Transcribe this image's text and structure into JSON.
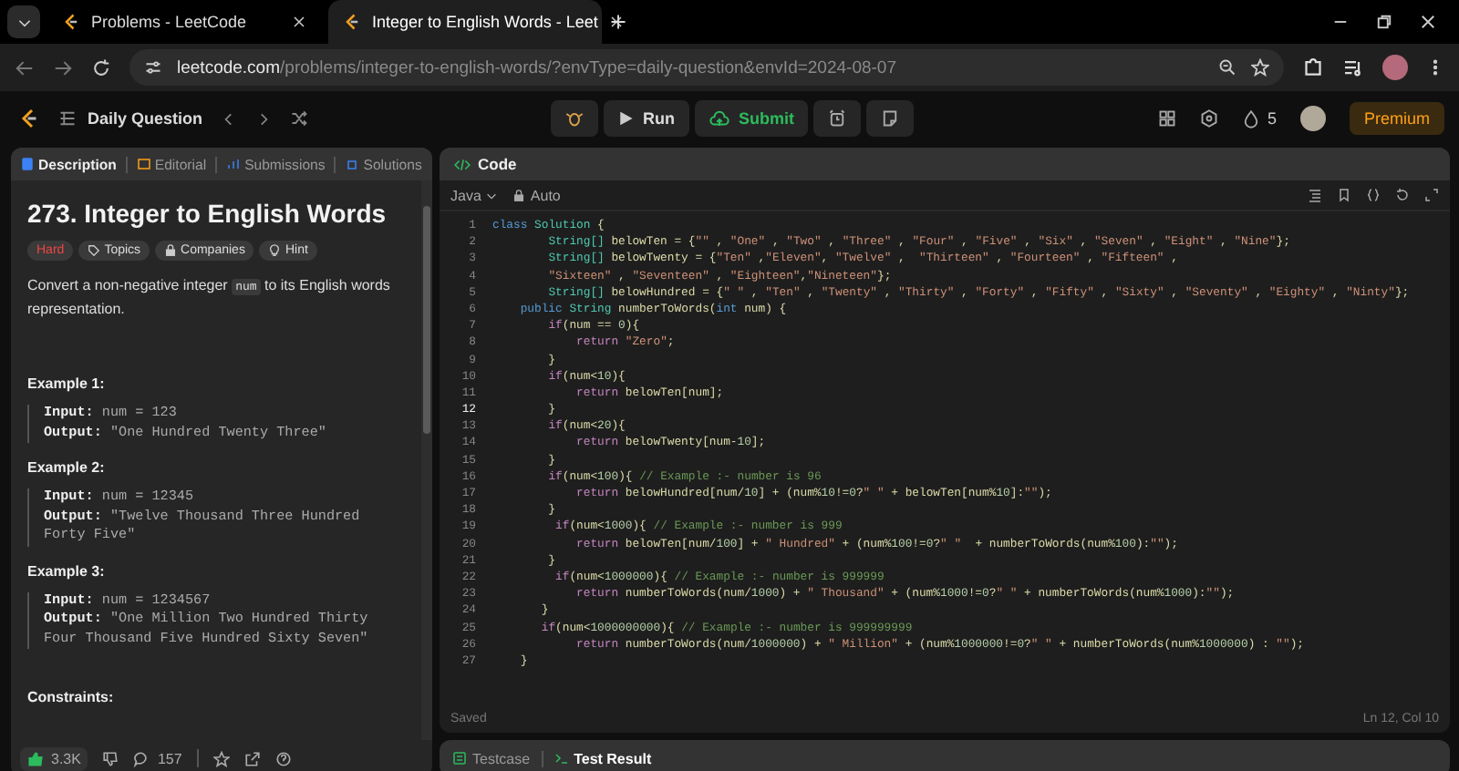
{
  "browser": {
    "tabs": [
      {
        "title": "Problems - LeetCode",
        "selected": false
      },
      {
        "title": "Integer to English Words - Leet",
        "selected": true
      }
    ],
    "url_host": "leetcode.com",
    "url_path": "/problems/integer-to-english-words/?envType=daily-question&envId=2024-08-07"
  },
  "topbar": {
    "daily": "Daily Question",
    "run": "Run",
    "submit": "Submit",
    "streak": "5",
    "premium": "Premium"
  },
  "description": {
    "tabs": [
      {
        "label": "Description",
        "selected": true
      },
      {
        "label": "Editorial",
        "selected": false
      },
      {
        "label": "Submissions",
        "selected": false
      },
      {
        "label": "Solutions",
        "selected": false
      }
    ],
    "title": "273. Integer to English Words",
    "tags": [
      {
        "label": "Hard",
        "kind": "difficulty"
      },
      {
        "label": "Topics",
        "kind": "topics"
      },
      {
        "label": "Companies",
        "kind": "companies"
      },
      {
        "label": "Hint",
        "kind": "hint"
      }
    ],
    "statement": [
      {
        "kind": "text",
        "text": "Convert a non-negative integer "
      },
      {
        "kind": "code",
        "text": "num"
      },
      {
        "kind": "text",
        "text": " to its English words representation."
      }
    ],
    "examples": [
      {
        "heading": "Example 1:",
        "input_label": "Input:",
        "input": "num = 123",
        "output_label": "Output:",
        "output": "\"One Hundred Twenty Three\""
      },
      {
        "heading": "Example 2:",
        "input_label": "Input:",
        "input": "num = 12345",
        "output_label": "Output:",
        "output": "\"Twelve Thousand Three Hundred Forty Five\""
      },
      {
        "heading": "Example 3:",
        "input_label": "Input:",
        "input": "num = 1234567",
        "output_label": "Output:",
        "output": "\"One Million Two Hundred Thirty Four Thousand Five Hundred Sixty Seven\""
      }
    ],
    "constraints": "Constraints:",
    "likes": "3.3K",
    "comments": "157"
  },
  "code": {
    "title": "Code",
    "language": "Java",
    "mode": "Auto",
    "lines": [
      {
        "no": "1",
        "text": "class Solution {",
        "current": false
      },
      {
        "no": "2",
        "text": "        String[] belowTen = {\"\" , \"One\" , \"Two\" , \"Three\" , \"Four\" , \"Five\" , \"Six\" , \"Seven\" , \"Eight\" , \"Nine\"};",
        "current": false
      },
      {
        "no": "3",
        "text": "        String[] belowTwenty = {\"Ten\" ,\"Eleven\", \"Twelve\" ,  \"Thirteen\" , \"Fourteen\" , \"Fifteen\" ,",
        "current": false
      },
      {
        "no": "4",
        "text": "        \"Sixteen\" , \"Seventeen\" , \"Eighteen\",\"Nineteen\"};",
        "current": false
      },
      {
        "no": "5",
        "text": "        String[] belowHundred = {\" \" , \"Ten\" , \"Twenty\" , \"Thirty\" , \"Forty\" , \"Fifty\" , \"Sixty\" , \"Seventy\" , \"Eighty\" , \"Ninty\"};",
        "current": false
      },
      {
        "no": "6",
        "text": "    public String numberToWords(int num) {",
        "current": false
      },
      {
        "no": "7",
        "text": "        if(num == 0){",
        "current": false
      },
      {
        "no": "8",
        "text": "            return \"Zero\";",
        "current": false
      },
      {
        "no": "9",
        "text": "        }",
        "current": false
      },
      {
        "no": "10",
        "text": "        if(num<10){",
        "current": false
      },
      {
        "no": "11",
        "text": "            return belowTen[num];",
        "current": false
      },
      {
        "no": "12",
        "text": "        }",
        "current": true
      },
      {
        "no": "13",
        "text": "        if(num<20){",
        "current": false
      },
      {
        "no": "14",
        "text": "            return belowTwenty[num-10];",
        "current": false
      },
      {
        "no": "15",
        "text": "        }",
        "current": false
      },
      {
        "no": "16",
        "text": "        if(num<100){ // Example :- number is 96",
        "current": false
      },
      {
        "no": "17",
        "text": "            return belowHundred[num/10] + (num%10!=0?\" \" + belowTen[num%10]:\"\");",
        "current": false
      },
      {
        "no": "18",
        "text": "        }",
        "current": false
      },
      {
        "no": "19",
        "text": "         if(num<1000){ // Example :- number is 999",
        "current": false
      },
      {
        "no": "20",
        "text": "            return belowTen[num/100] + \" Hundred\" + (num%100!=0?\" \"  + numberToWords(num%100):\"\");",
        "current": false
      },
      {
        "no": "21",
        "text": "        }",
        "current": false
      },
      {
        "no": "22",
        "text": "         if(num<1000000){ // Example :- number is 999999",
        "current": false
      },
      {
        "no": "23",
        "text": "            return numberToWords(num/1000) + \" Thousand\" + (num%1000!=0?\" \" + numberToWords(num%1000):\"\");",
        "current": false
      },
      {
        "no": "24",
        "text": "       }",
        "current": false
      },
      {
        "no": "25",
        "text": "       if(num<1000000000){ // Example :- number is 999999999",
        "current": false
      },
      {
        "no": "26",
        "text": "            return numberToWords(num/1000000) + \" Million\" + (num%1000000!=0?\" \" + numberToWords(num%1000000) : \"\");",
        "current": false
      },
      {
        "no": "27",
        "text": "    }",
        "current": false
      }
    ],
    "status": "Saved",
    "position": "Ln 12, Col 10"
  },
  "bottom_tabs": [
    {
      "label": "Testcase",
      "selected": false
    },
    {
      "label": "Test Result",
      "selected": true
    }
  ]
}
